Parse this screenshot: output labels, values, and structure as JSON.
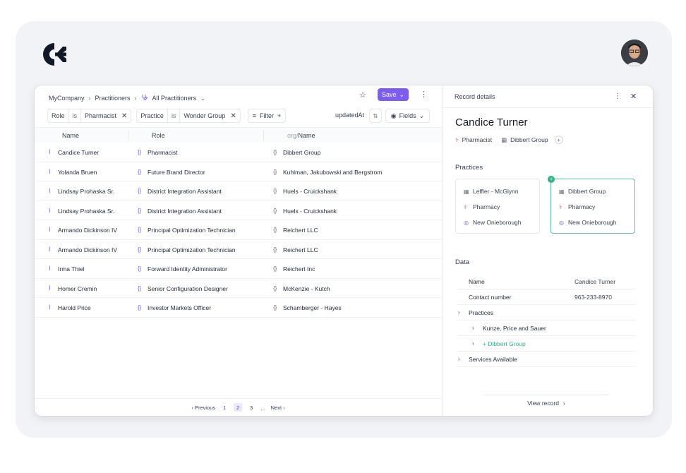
{
  "breadcrumb": {
    "company": "MyCompany",
    "section": "Practitioners",
    "view": "All Practitioners"
  },
  "toolbar": {
    "save_label": "Save"
  },
  "filters": [
    {
      "field": "Role",
      "op": "is",
      "value": "Pharmacist"
    },
    {
      "field": "Practice",
      "op": "is",
      "value": "Wonder Group"
    }
  ],
  "filter_button": "Filter",
  "sort_label": "updatedAt",
  "fields_button": "Fields",
  "columns": {
    "name": "Name",
    "role": "Role",
    "org_prefix": "org/",
    "org": "Name"
  },
  "rows": [
    {
      "name": "Candice Turner",
      "role": "Pharmacist",
      "org": "Dibbert Group"
    },
    {
      "name": "Yolanda Bruen",
      "role": "Future Brand Director",
      "org": "Kuhlman, Jakubowski and Bergstrom"
    },
    {
      "name": "Lindsay Prohaska Sr.",
      "role": "District Integration Assistant",
      "org": "Huels - Cruickshank"
    },
    {
      "name": "Lindsay Prohaska Sr.",
      "role": "District Integration Assistant",
      "org": "Huels - Cruickshank"
    },
    {
      "name": "Armando Dickinson IV",
      "role": "Principal Optimization Technician",
      "org": "Reichert LLC"
    },
    {
      "name": "Armando Dickinson IV",
      "role": "Principal Optimization Technician",
      "org": "Reichert LLC"
    },
    {
      "name": "Irma Thiel",
      "role": "Forward Identity Administrator",
      "org": "Reichert Inc"
    },
    {
      "name": "Homer Cremin",
      "role": "Senior Configuration Designer",
      "org": "McKenzie - Kutch"
    },
    {
      "name": "Harold Price",
      "role": "Investor Markets Officer",
      "org": "Schamberger - Hayes"
    }
  ],
  "pagination": {
    "previous": "Previous",
    "pages": [
      "1",
      "2",
      "3"
    ],
    "ellipsis": "…",
    "next": "Next",
    "current": "2"
  },
  "record": {
    "panel_title": "Record details",
    "name": "Candice Turner",
    "role_tag": "Pharmacist",
    "org_tag": "Dibbert Group",
    "practices_label": "Practices",
    "practices": [
      {
        "org": "Leffler - McGlynn",
        "type": "Pharmacy",
        "location": "New Onieborough",
        "selected": false
      },
      {
        "org": "Dibbert Group",
        "type": "Pharmacy",
        "location": "New Onieborough",
        "selected": true
      }
    ],
    "data_label": "Data",
    "data": {
      "name_key": "Name",
      "name_value": "Candice Turner",
      "contact_key": "Contact number",
      "contact_value": "963-233-8970",
      "practices_key": "Practices",
      "practice_1": "Kunze, Price and Sauer",
      "practice_2": "+ Dibbert Group",
      "services_key": "Services Available"
    },
    "view_record": "View record"
  },
  "colors": {
    "accent": "#7c5cf5",
    "green": "#34b386",
    "pink": "#e0578f"
  }
}
